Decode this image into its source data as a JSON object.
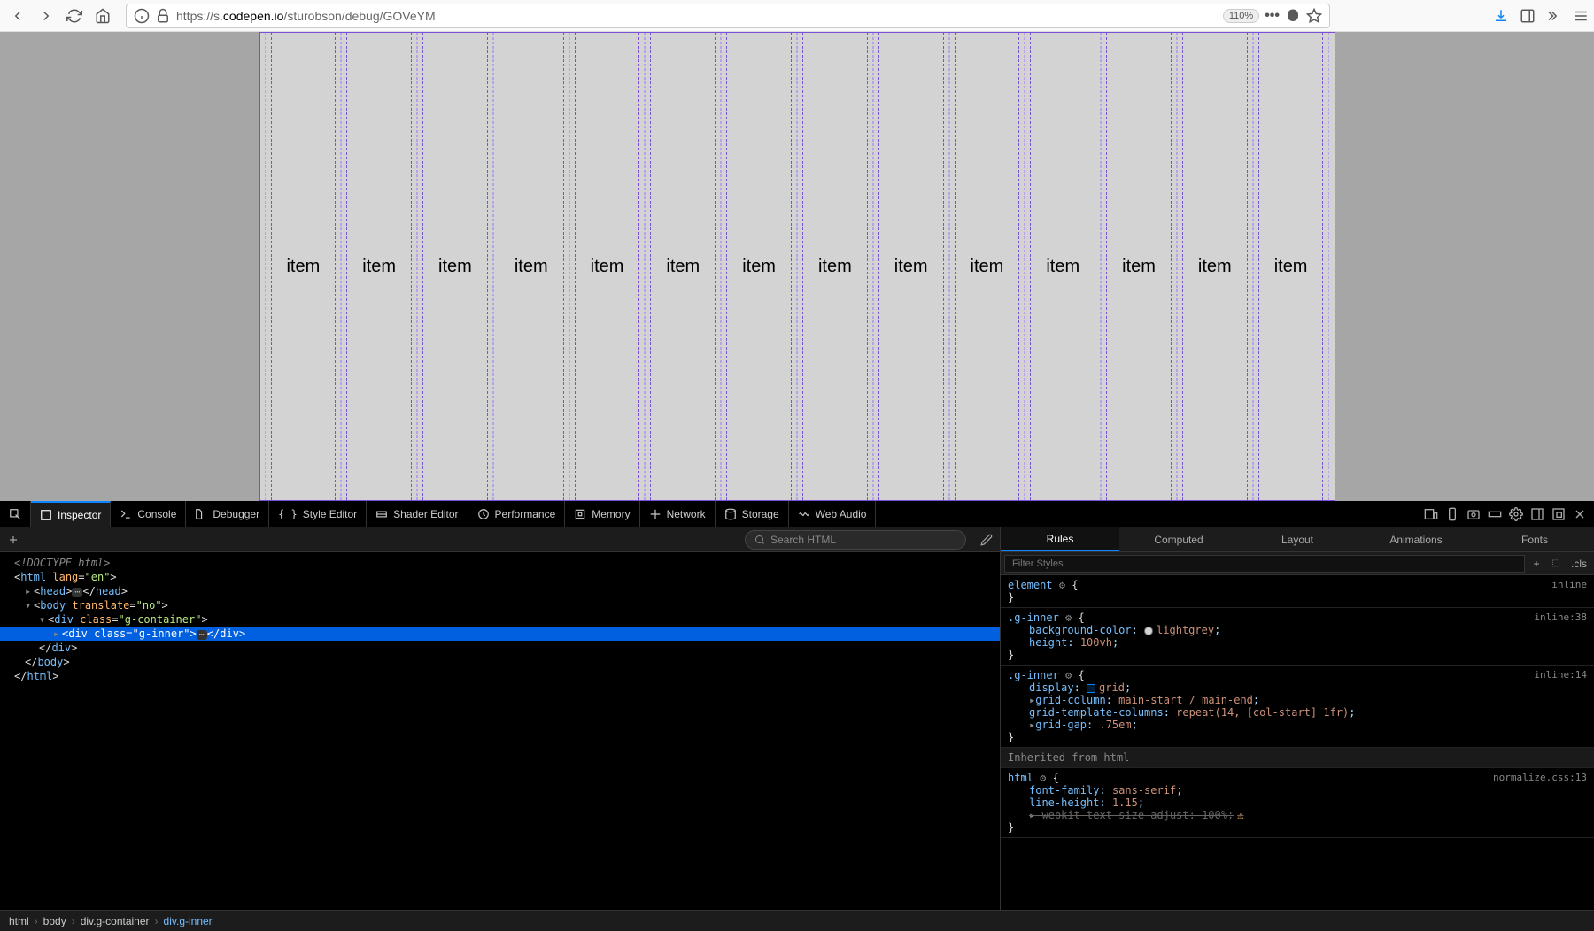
{
  "chrome": {
    "url_scheme": "https://s.",
    "url_domain": "codepen.io",
    "url_path": "/sturobson/debug/GOVeYM",
    "zoom": "110%"
  },
  "page": {
    "items": [
      "item",
      "item",
      "item",
      "item",
      "item",
      "item",
      "item",
      "item",
      "item",
      "item",
      "item",
      "item",
      "item",
      "item"
    ]
  },
  "devtools": {
    "tabs": [
      "Inspector",
      "Console",
      "Debugger",
      "Style Editor",
      "Shader Editor",
      "Performance",
      "Memory",
      "Network",
      "Storage",
      "Web Audio"
    ],
    "active_tab": "Inspector",
    "search_placeholder": "Search HTML",
    "dom": {
      "doctype": "<!DOCTYPE html>",
      "html_open": "<html lang=\"en\">",
      "head": "<head>…</head>",
      "body_open": "<body translate=\"no\">",
      "gcontainer": "<div class=\"g-container\">",
      "ginner": "<div class=\"g-inner\">…</div>",
      "div_close": "</div>",
      "body_close": "</body>",
      "html_close": "</html>"
    },
    "rules_tabs": [
      "Rules",
      "Computed",
      "Layout",
      "Animations",
      "Fonts"
    ],
    "active_rules_tab": "Rules",
    "filter_placeholder": "Filter Styles",
    "cls_label": ".cls",
    "rules": {
      "element_sel": "element",
      "inline": "inline",
      "ginner_sel": ".g-inner",
      "inline38": "inline:38",
      "bg_prop": "background-color",
      "bg_val": "lightgrey",
      "height_prop": "height",
      "height_val": "100vh",
      "inline14": "inline:14",
      "display_prop": "display",
      "display_val": "grid",
      "gridcol_prop": "grid-column",
      "gridcol_val": "main-start / main-end",
      "gtc_prop": "grid-template-columns",
      "gtc_val": "repeat(14, [col-start] 1fr)",
      "gridgap_prop": "grid-gap",
      "gridgap_val": ".75em",
      "inherited": "Inherited from html",
      "html_sel": "html",
      "normalize": "normalize.css:13",
      "ff_prop": "font-family",
      "ff_val": "sans-serif",
      "lh_prop": "line-height",
      "lh_val": "1.15",
      "wtsa_prop": "-webkit-text-size-adjust",
      "wtsa_val": "100%"
    },
    "breadcrumb": [
      "html",
      "body",
      "div.g-container",
      "div.g-inner"
    ]
  }
}
